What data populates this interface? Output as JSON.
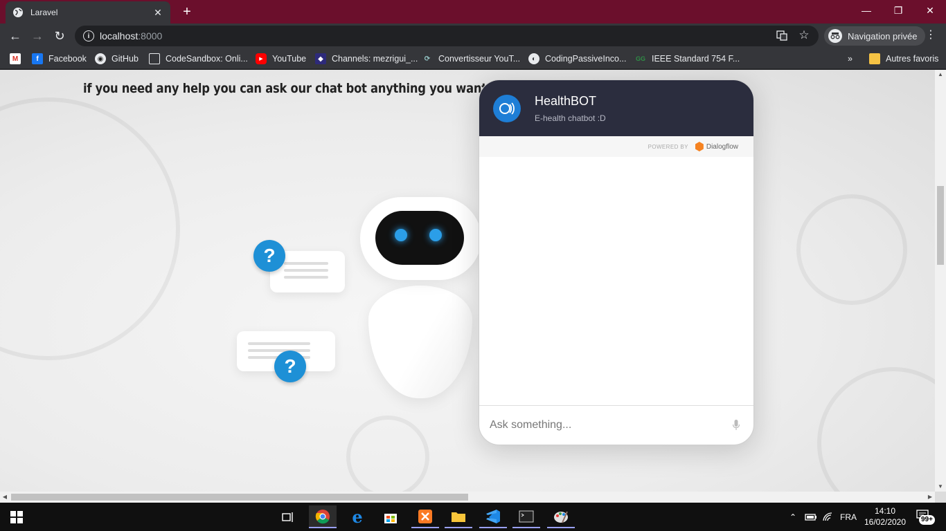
{
  "browser": {
    "tab_title": "Laravel",
    "url_host": "localhost",
    "url_port": ":8000",
    "profile_label": "Navigation privée",
    "accent_color": "#6b0f2c"
  },
  "bookmarks": {
    "items": [
      {
        "label": "",
        "icon": "gmail-icon"
      },
      {
        "label": "Facebook",
        "icon": "facebook-icon"
      },
      {
        "label": "GitHub",
        "icon": "github-icon"
      },
      {
        "label": "CodeSandbox: Onli...",
        "icon": "codesandbox-icon"
      },
      {
        "label": "YouTube",
        "icon": "youtube-icon"
      },
      {
        "label": "Channels: mezrigui_...",
        "icon": "channels-icon"
      },
      {
        "label": "Convertisseur YouT...",
        "icon": "converter-icon"
      },
      {
        "label": "CodingPassiveInco...",
        "icon": "globe-icon"
      },
      {
        "label": "IEEE Standard 754 F...",
        "icon": "gfg-icon"
      }
    ],
    "overflow_label": "»",
    "other_label": "Autres favoris"
  },
  "page": {
    "headline": "if you need any help you can ask our chat bot anything you want"
  },
  "chat": {
    "title": "HealthBOT",
    "subtitle": "E-health chatbot :D",
    "powered_by": "POWERED BY",
    "provider": "Dialogflow",
    "input_placeholder": "Ask something...",
    "header_color": "#2b2d3e",
    "brand_color": "#f58220"
  },
  "taskbar": {
    "language": "FRA",
    "time": "14:10",
    "date": "16/02/2020",
    "notifications": "99+"
  }
}
